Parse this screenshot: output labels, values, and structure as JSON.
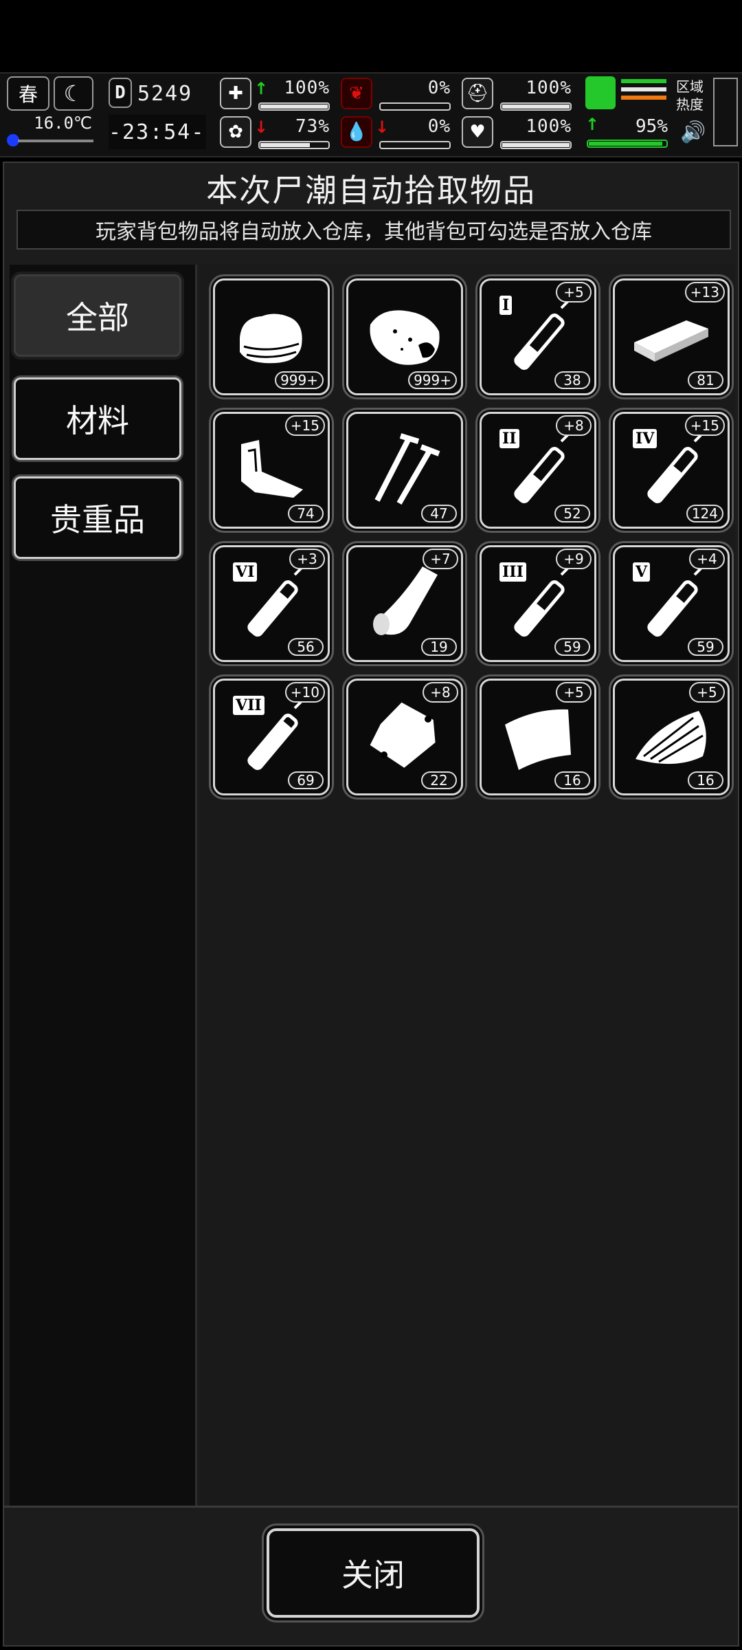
{
  "hud": {
    "season": "春",
    "temperature": "16.0℃",
    "day_label": "D",
    "day_number": "5249",
    "time": "-23:54-",
    "stats": [
      {
        "name": "health",
        "icon": "medkit-icon",
        "arrow": "up",
        "value": "100%",
        "level": 1.0
      },
      {
        "name": "hunger",
        "icon": "stomach-icon",
        "arrow": "",
        "value": "0%",
        "level": 0.0
      },
      {
        "name": "armor",
        "icon": "helmet-icon",
        "arrow": "",
        "value": "100%",
        "level": 1.0
      },
      {
        "name": "sanity",
        "icon": "brain-icon",
        "arrow": "down",
        "value": "73%",
        "level": 0.73
      },
      {
        "name": "thirst",
        "icon": "blood-drop-icon",
        "arrow": "down",
        "value": "0%",
        "level": 0.0
      },
      {
        "name": "mood",
        "icon": "heart-icon",
        "arrow": "",
        "value": "100%",
        "level": 1.0
      }
    ],
    "stamina": {
      "value": "95%",
      "level": 0.95,
      "arrow": "up"
    },
    "zone_heat_label": "区域热度"
  },
  "panel": {
    "title": "本次尸潮自动拾取物品",
    "subtitle": "玩家背包物品将自动放入仓库，其他背包可勾选是否放入仓库"
  },
  "categories": [
    {
      "label": "全部",
      "active": true
    },
    {
      "label": "材料",
      "active": false
    },
    {
      "label": "贵重品",
      "active": false
    }
  ],
  "items": [
    {
      "icon": "cloth-icon",
      "count": "999+",
      "plus": ""
    },
    {
      "icon": "raw-meat-icon",
      "count": "999+",
      "plus": ""
    },
    {
      "icon": "syringe-1-icon",
      "roman": "I",
      "count": "38",
      "plus": "+5"
    },
    {
      "icon": "wood-plank-icon",
      "count": "81",
      "plus": "+13"
    },
    {
      "icon": "scrap-metal-icon",
      "count": "74",
      "plus": "+15"
    },
    {
      "icon": "nails-icon",
      "count": "47",
      "plus": ""
    },
    {
      "icon": "syringe-2-icon",
      "roman": "II",
      "count": "52",
      "plus": "+8"
    },
    {
      "icon": "syringe-4-icon",
      "roman": "IV",
      "count": "124",
      "plus": "+15"
    },
    {
      "icon": "syringe-6-icon",
      "roman": "VI",
      "count": "56",
      "plus": "+3"
    },
    {
      "icon": "leather-icon",
      "count": "19",
      "plus": "+7"
    },
    {
      "icon": "syringe-3-icon",
      "roman": "III",
      "count": "59",
      "plus": "+9"
    },
    {
      "icon": "syringe-5-icon",
      "roman": "V",
      "count": "59",
      "plus": "+4"
    },
    {
      "icon": "syringe-7-icon",
      "roman": "VII",
      "count": "69",
      "plus": "+10"
    },
    {
      "icon": "bag-icon",
      "count": "22",
      "plus": "+8"
    },
    {
      "icon": "paper-sheet-icon",
      "count": "16",
      "plus": "+5"
    },
    {
      "icon": "feather-bundle-icon",
      "count": "16",
      "plus": "+5"
    }
  ],
  "close_label": "关闭"
}
